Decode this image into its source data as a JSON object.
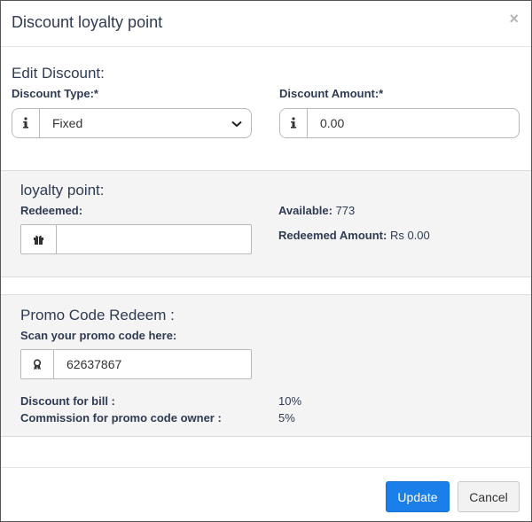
{
  "modal": {
    "title": "Discount loyalty point",
    "close_symbol": "×"
  },
  "edit_discount": {
    "heading": "Edit Discount:",
    "type_label": "Discount Type:*",
    "type_value": "Fixed",
    "type_icon": "info-icon",
    "amount_label": "Discount Amount:*",
    "amount_value": "0.00",
    "amount_icon": "info-icon"
  },
  "loyalty": {
    "heading": "loyalty point:",
    "redeemed_label": "Redeemed:",
    "redeemed_value": "",
    "redeemed_icon": "gift-icon",
    "available_label": "Available:",
    "available_value": "773",
    "redeemed_amount_label": "Redeemed Amount:",
    "redeemed_amount_value": "Rs 0.00"
  },
  "promo": {
    "heading": "Promo Code Redeem :",
    "scan_label": "Scan your promo code here:",
    "code_value": "62637867",
    "code_icon": "award-icon",
    "discount_label": "Discount for bill :",
    "discount_value": "10%",
    "commission_label": "Commission for promo code owner :",
    "commission_value": "5%"
  },
  "footer": {
    "update_label": "Update",
    "cancel_label": "Cancel"
  },
  "colors": {
    "primary": "#1a7fe8",
    "section_bg": "#f4f4f4"
  }
}
